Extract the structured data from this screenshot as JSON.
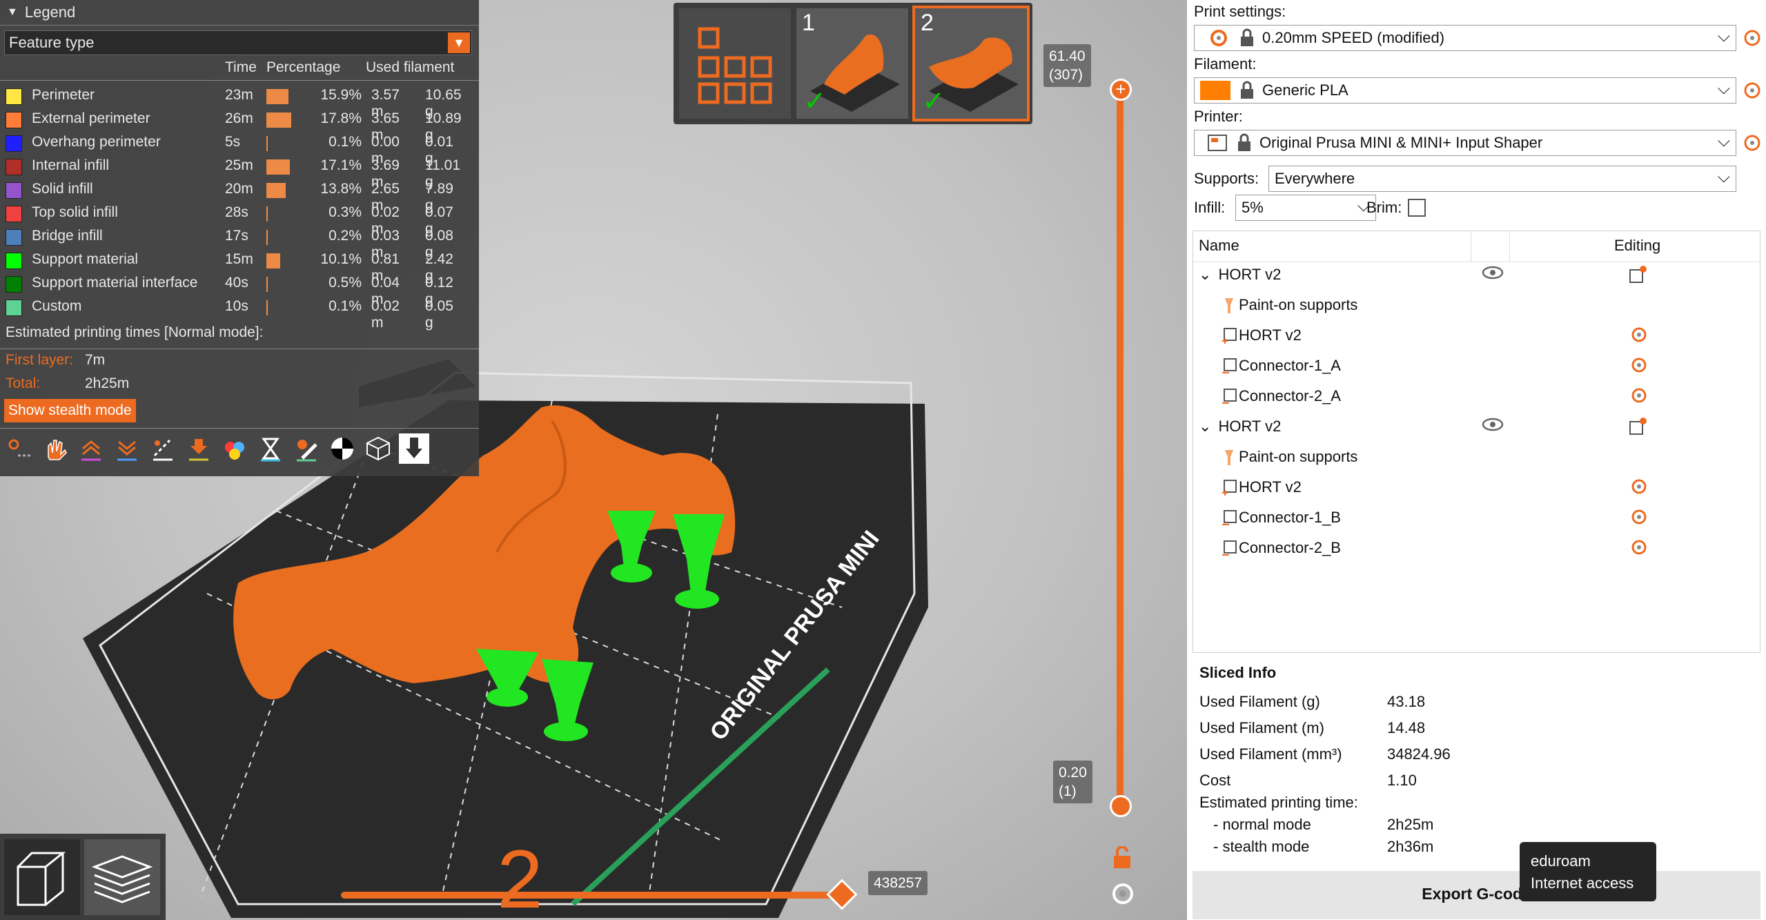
{
  "legend": {
    "title": "Legend",
    "view_type": "Feature type",
    "columns": {
      "time": "Time",
      "percentage": "Percentage",
      "filament": "Used filament"
    },
    "rows": [
      {
        "name": "Perimeter",
        "color": "#ffe642",
        "time": "23m",
        "percent": "15.9%",
        "length": "3.57 m",
        "weight": "10.65 g",
        "fraction": 0.159
      },
      {
        "name": "External perimeter",
        "color": "#ff7d38",
        "time": "26m",
        "percent": "17.8%",
        "length": "3.65 m",
        "weight": "10.89 g",
        "fraction": 0.178
      },
      {
        "name": "Overhang perimeter",
        "color": "#1f1fff",
        "time": "5s",
        "percent": "0.1%",
        "length": "0.00 m",
        "weight": "0.01 g",
        "fraction": 0.001
      },
      {
        "name": "Internal infill",
        "color": "#b03029",
        "time": "25m",
        "percent": "17.1%",
        "length": "3.69 m",
        "weight": "11.01 g",
        "fraction": 0.171
      },
      {
        "name": "Solid infill",
        "color": "#9654cc",
        "time": "20m",
        "percent": "13.8%",
        "length": "2.65 m",
        "weight": "7.89 g",
        "fraction": 0.138
      },
      {
        "name": "Top solid infill",
        "color": "#f04040",
        "time": "28s",
        "percent": "0.3%",
        "length": "0.02 m",
        "weight": "0.07 g",
        "fraction": 0.003
      },
      {
        "name": "Bridge infill",
        "color": "#4d80ba",
        "time": "17s",
        "percent": "0.2%",
        "length": "0.03 m",
        "weight": "0.08 g",
        "fraction": 0.002
      },
      {
        "name": "Support material",
        "color": "#00ff00",
        "time": "15m",
        "percent": "10.1%",
        "length": "0.81 m",
        "weight": "2.42 g",
        "fraction": 0.101
      },
      {
        "name": "Support material interface",
        "color": "#008000",
        "time": "40s",
        "percent": "0.5%",
        "length": "0.04 m",
        "weight": "0.12 g",
        "fraction": 0.005
      },
      {
        "name": "Custom",
        "color": "#5ed194",
        "time": "10s",
        "percent": "0.1%",
        "length": "0.02 m",
        "weight": "0.05 g",
        "fraction": 0.001
      }
    ],
    "estimated_title": "Estimated printing times [Normal mode]:",
    "first_layer_label": "First layer:",
    "first_layer_value": "7m",
    "total_label": "Total:",
    "total_value": "2h25m",
    "stealth_button": "Show stealth mode"
  },
  "plates": {
    "thumb1_number": "1",
    "thumb2_number": "2",
    "check": "✓"
  },
  "vslider": {
    "top_value": "61.40",
    "top_layer": "(307)",
    "bottom_value": "0.20",
    "bottom_layer": "(1)"
  },
  "hslider": {
    "value": "438257"
  },
  "bed_label": "ORIGINAL PRUSA MINI",
  "panel": {
    "print_settings_label": "Print settings:",
    "print_settings_value": "0.20mm SPEED (modified)",
    "filament_label": "Filament:",
    "filament_value": "Generic PLA",
    "filament_color": "#ff8000",
    "printer_label": "Printer:",
    "printer_value": "Original Prusa MINI & MINI+ Input Shaper",
    "supports_label": "Supports:",
    "supports_value": "Everywhere",
    "infill_label": "Infill:",
    "infill_value": "5%",
    "brim_label": "Brim:",
    "tree_headers": {
      "name": "Name",
      "editing": "Editing"
    },
    "objects": [
      {
        "name": "HORT v2",
        "children": [
          {
            "name": "Paint-on supports",
            "kind": "paint"
          },
          {
            "name": "HORT v2",
            "kind": "part"
          },
          {
            "name": "Connector-1_A",
            "kind": "neg"
          },
          {
            "name": "Connector-2_A",
            "kind": "neg"
          }
        ]
      },
      {
        "name": "HORT v2",
        "children": [
          {
            "name": "Paint-on supports",
            "kind": "paint"
          },
          {
            "name": "HORT v2",
            "kind": "part"
          },
          {
            "name": "Connector-1_B",
            "kind": "neg"
          },
          {
            "name": "Connector-2_B",
            "kind": "neg"
          }
        ]
      }
    ],
    "sliced_title": "Sliced Info",
    "sliced": [
      {
        "k": "Used Filament (g)",
        "v": "43.18"
      },
      {
        "k": "Used Filament (m)",
        "v": "14.48"
      },
      {
        "k": "Used Filament (mm³)",
        "v": "34824.96"
      },
      {
        "k": "Cost",
        "v": "1.10"
      }
    ],
    "est_title": "Estimated printing time:",
    "normal_label": "- normal mode",
    "normal_value": "2h25m",
    "stealth_label": "- stealth mode",
    "stealth_value": "2h36m",
    "export_label": "Export G-code"
  },
  "tooltip": {
    "line1": "eduroam",
    "line2": "Internet access"
  },
  "accent": "#ed6b21"
}
